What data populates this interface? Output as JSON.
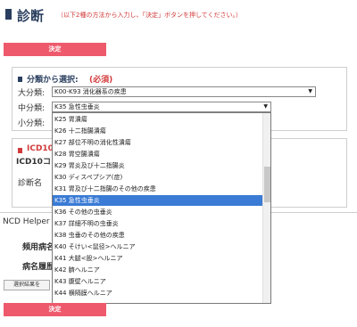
{
  "header": {
    "title": "診断",
    "note": "（以下2種の方法から入力し、「決定」ボタンを押してください。）"
  },
  "buttons": {
    "decide_top": "決定",
    "decide_bottom": "決定",
    "result": "選択結果を"
  },
  "category": {
    "title": "分類から選択:",
    "required": "(必須)",
    "major_label": "大分類:",
    "major_value": "K00-K93 消化器系の疾患",
    "middle_label": "中分類:",
    "middle_value": "K35 急性虫垂炎",
    "minor_label": "小分類:"
  },
  "icd": {
    "title": "ICD10",
    "sub": "ICD10コ",
    "diag_label": "診断名"
  },
  "ncd": {
    "helper": "NCD Helper",
    "freq_label": "頻用病名",
    "history_label": "病名履歴"
  },
  "dropdown": {
    "items": [
      "K25 胃潰瘍",
      "K26 十二指腸潰瘍",
      "K27 部位不明の消化性潰瘍",
      "K28 胃空腸潰瘍",
      "K29 胃炎及び十二指腸炎",
      "K30 ディスペプシア(症)",
      "K31 胃及び十二指腸のその他の疾患",
      "K35 急性虫垂炎",
      "K36 その他の虫垂炎",
      "K37 詳細不明の虫垂炎",
      "K38 虫垂のその他の疾患",
      "K40 そけい<鼠径>ヘルニア",
      "K41 大腿<股>ヘルニア",
      "K42 臍ヘルニア",
      "K43 腹壁ヘルニア",
      "K44 横隔膜ヘルニア"
    ],
    "selected_index": 7
  },
  "colors": {
    "accent_red": "#ee5a6c",
    "title_navy": "#2a3f5f",
    "selection_blue": "#3a7bd5"
  }
}
